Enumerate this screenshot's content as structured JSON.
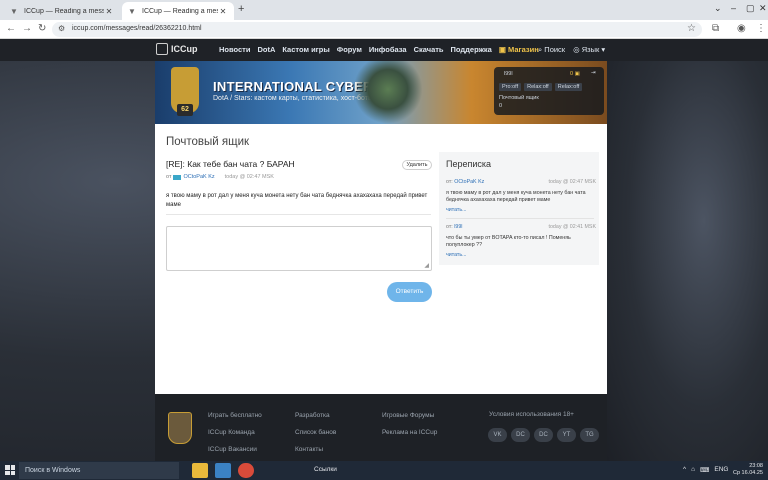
{
  "browser": {
    "tabs": [
      {
        "title": "ICCup — Reading a message f..."
      },
      {
        "title": "ICCup — Reading a message f..."
      }
    ],
    "url": "iccup.com/messages/read/26362210.html"
  },
  "site": {
    "logo_text": "ICCup",
    "nav": [
      "Новости",
      "DotA",
      "Кастом игры",
      "Форум",
      "Инфобаза",
      "Скачать",
      "Поддержка"
    ],
    "shop": "Магазин",
    "search": "Поиск",
    "language": "Язык"
  },
  "banner": {
    "title": "INTERNATIONAL CYBER CUP",
    "subtitle": "DotA / Stars: кастом карты, статистика, хост-боты",
    "level": "62"
  },
  "user_panel": {
    "name": "l99l",
    "coins": "0",
    "buttons": [
      "Pro:off",
      "Relax:off",
      "Relax:off"
    ],
    "mail_label": "Почтовый ящик",
    "count": "0"
  },
  "page": {
    "title": "Почтовый ящик",
    "message_title": "[RE]: Как тебе бан чата ? БАРАН",
    "delete_label": "Удалить",
    "from_prefix": "от",
    "author": "OCtoPaK Kz",
    "timestamp": "today @ 02:47 MSK",
    "body": "я твою маму в рот дал у меня куча монета нету бан чата беднячка ахахахаха передай привет маме",
    "reply_placeholder": "",
    "send_label": "Ответить"
  },
  "sidebar": {
    "heading": "Переписка",
    "items": [
      {
        "from_prefix": "от:",
        "from": "OCtoPaK Kz",
        "time": "today @ 02:47 MSK",
        "text": "я твою маму в рот дал у меня куча монета нету бан чата беднячка ахахахаха передай привет маме",
        "more": "читать..."
      },
      {
        "from_prefix": "от:",
        "from": "l99l",
        "time": "today @ 02:41 MSK",
        "text": "что бы ты умер от BOTAPA кто-то писал ! Поменяь полуплокер ??",
        "more": "читать..."
      }
    ]
  },
  "footer": {
    "col1": [
      "Играть бесплатно",
      "ICCup Команда",
      "ICCup Вакансии"
    ],
    "col2": [
      "Разработка",
      "Список банов",
      "Контакты"
    ],
    "col3": [
      "Игровые Форумы",
      "Реклама на ICCup"
    ],
    "terms": "Условия использования 18+",
    "social": [
      "VK",
      "DC",
      "DC",
      "YT",
      "TG"
    ]
  },
  "taskbar": {
    "search_placeholder": "Поиск в Windows",
    "app_label": "Ссылки",
    "lang": "ENG",
    "time": "23:08",
    "date": "Ср 16.04.25"
  }
}
